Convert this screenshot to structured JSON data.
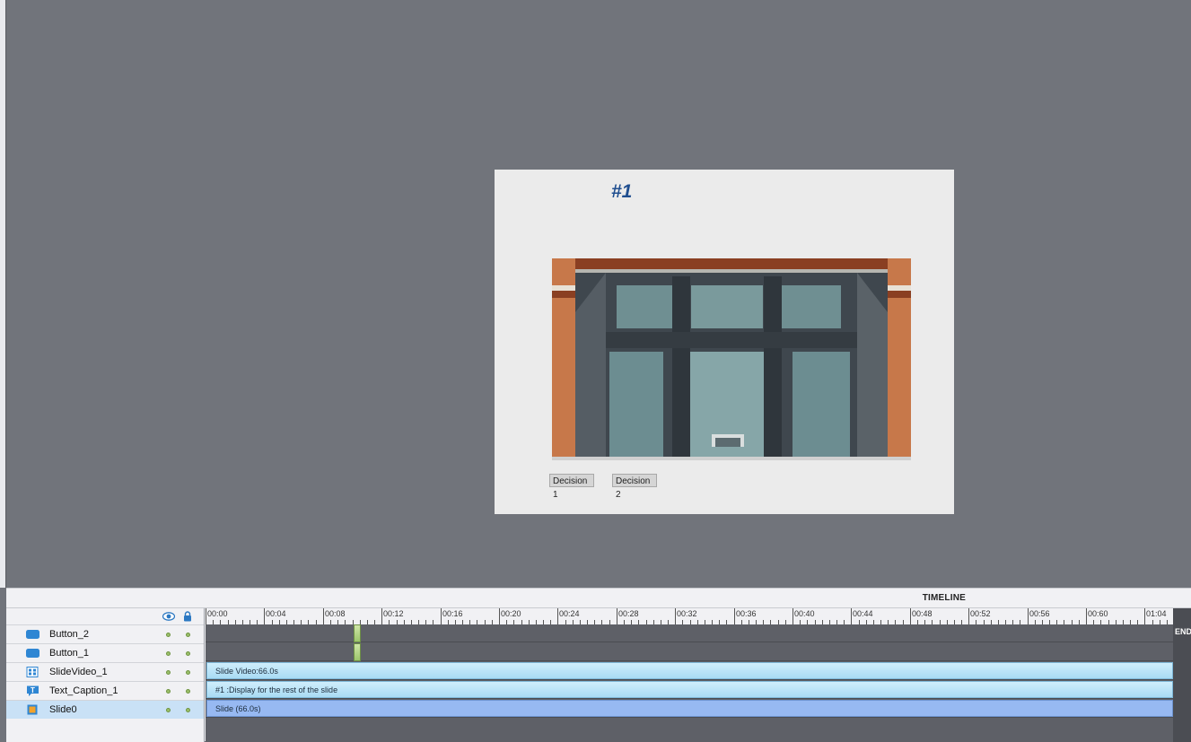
{
  "slide": {
    "caption": "#1",
    "buttons": [
      "Decision 1",
      "Decision 2"
    ]
  },
  "timeline": {
    "title": "TIMELINE",
    "ruler": [
      "00:00",
      "00:04",
      "00:08",
      "00:12",
      "00:16",
      "00:20",
      "00:24",
      "00:28",
      "00:32",
      "00:36",
      "00:40",
      "00:44",
      "00:48",
      "00:52",
      "00:56",
      "00:60",
      "01:04"
    ],
    "end_label": "END",
    "layers": [
      {
        "name": "Button_2",
        "icon": "button-icon",
        "bar": ""
      },
      {
        "name": "Button_1",
        "icon": "button-icon",
        "bar": ""
      },
      {
        "name": "SlideVideo_1",
        "icon": "video-icon",
        "bar": "Slide Video:66.0s"
      },
      {
        "name": "Text_Caption_1",
        "icon": "text-caption-icon",
        "bar": "#1 :Display for the rest of the slide"
      },
      {
        "name": "Slide0",
        "icon": "slide-icon",
        "bar": "Slide (66.0s)"
      }
    ]
  },
  "colors": {
    "stage": "#71747b",
    "caption": "#1f4e8f",
    "selected_row": "#c9e1f6",
    "bar_light": "#a9dbf4",
    "bar_slide": "#97b9f2"
  }
}
